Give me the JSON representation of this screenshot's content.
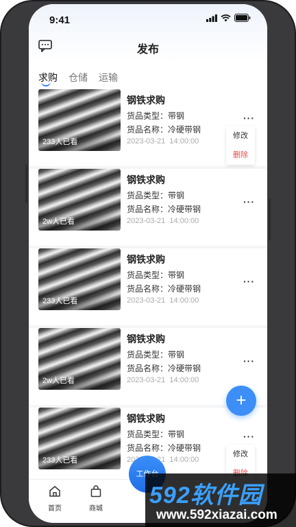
{
  "status": {
    "time": "9:41"
  },
  "header": {
    "title": "发布",
    "message_icon": "chat-icon"
  },
  "tabs": [
    {
      "label": "求购",
      "active": true
    },
    {
      "label": "仓储",
      "active": false
    },
    {
      "label": "运输",
      "active": false
    }
  ],
  "cards": [
    {
      "title": "钢铁求购",
      "type_label": "货品类型：",
      "type": "带钢",
      "name_label": "货品名称：",
      "name": "冷硬带钢",
      "date": "2023-03-21",
      "time": "14:00:00",
      "views": "233人已看",
      "more": "···"
    },
    {
      "title": "钢铁求购",
      "type_label": "货品类型：",
      "type": "带钢",
      "name_label": "货品名称：",
      "name": "冷硬带钢",
      "date": "2023-03-21",
      "time": "14:00:00",
      "views": "2w人已看",
      "more": "···"
    },
    {
      "title": "钢铁求购",
      "type_label": "货品类型：",
      "type": "带钢",
      "name_label": "货品名称：",
      "name": "冷硬带钢",
      "date": "2023-03-21",
      "time": "14:00:00",
      "views": "233人已看",
      "more": "···"
    },
    {
      "title": "钢铁求购",
      "type_label": "货品类型：",
      "type": "带钢",
      "name_label": "货品名称：",
      "name": "冷硬带钢",
      "date": "2023-03-21",
      "time": "14:00:00",
      "views": "2w人已看",
      "more": "···"
    },
    {
      "title": "钢铁求购",
      "type_label": "货品类型：",
      "type": "带钢",
      "name_label": "货品名称：",
      "name": "冷硬带钢",
      "date": "2023-03-21",
      "time": "14:00:00",
      "views": "233人已看",
      "more": "···"
    }
  ],
  "popup": {
    "edit": "修改",
    "delete": "删除"
  },
  "fab": {
    "label": "+"
  },
  "tabbar": {
    "home": "首页",
    "mall": "商城",
    "workbench": "工作台"
  },
  "watermark": {
    "brand": "592软件园",
    "url": "www.592xiazai.com"
  },
  "colors": {
    "accent": "#3d8ef7",
    "delete": "#e84a4a"
  }
}
